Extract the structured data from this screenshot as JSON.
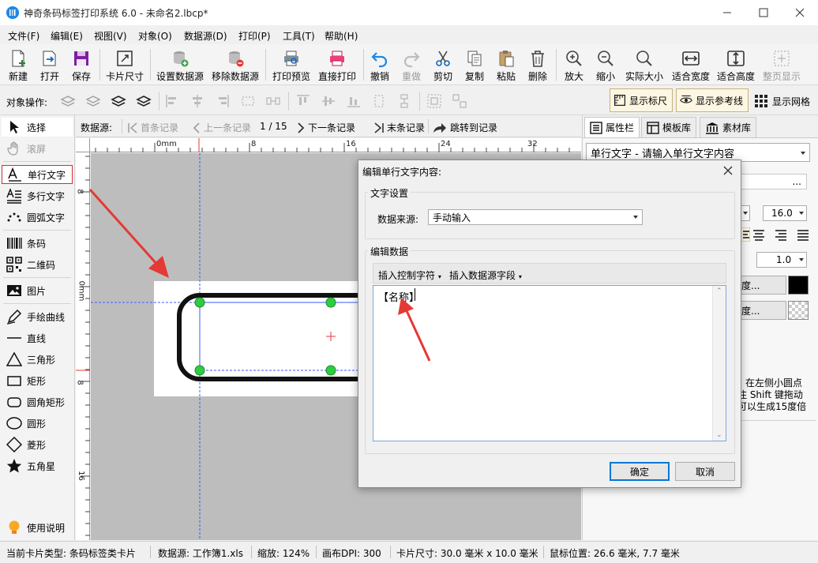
{
  "window": {
    "title": "神奇条码标签打印系统 6.0 - 未命名2.lbcp*",
    "app_icon": "app-logo-icon"
  },
  "menu": [
    "文件(F)",
    "编辑(E)",
    "视图(V)",
    "对象(O)",
    "数据源(D)",
    "打印(P)",
    "工具(T)",
    "帮助(H)"
  ],
  "toolbar": {
    "new": "新建",
    "open": "打开",
    "save": "保存",
    "card_size": "卡片尺寸",
    "set_datasource": "设置数据源",
    "remove_datasource": "移除数据源",
    "print_preview": "打印预览",
    "direct_print": "直接打印",
    "undo": "撤销",
    "redo": "重做",
    "cut": "剪切",
    "copy": "复制",
    "paste": "粘贴",
    "delete": "删除",
    "zoom_in": "放大",
    "zoom_out": "缩小",
    "actual_size": "实际大小",
    "fit_width": "适合宽度",
    "fit_height": "适合高度",
    "full_page": "整页显示"
  },
  "objbar": {
    "label": "对象操作:",
    "show_ruler": "显示标尺",
    "show_guides": "显示参考线",
    "show_grid": "显示网格"
  },
  "tools": {
    "select": "选择",
    "scroll": "滚屏",
    "single_text": "单行文字",
    "multi_text": "多行文字",
    "arc_text": "圆弧文字",
    "barcode": "条码",
    "qrcode": "二维码",
    "image": "图片",
    "freehand": "手绘曲线",
    "line": "直线",
    "triangle": "三角形",
    "rect": "矩形",
    "round_rect": "圆角矩形",
    "ellipse": "圆形",
    "diamond": "菱形",
    "star": "五角星",
    "help": "使用说明"
  },
  "recnav": {
    "label": "数据源:",
    "first": "首条记录",
    "prev": "上一条记录",
    "counter": "1 / 15",
    "next": "下一条记录",
    "last": "末条记录",
    "goto": "跳转到记录"
  },
  "ruler": {
    "h_labels": [
      "0mm",
      "8",
      "16",
      "24",
      "32"
    ],
    "v_labels": [
      "8",
      "0mm",
      "8",
      "16"
    ]
  },
  "rightpanel": {
    "tabs": [
      "属性栏",
      "模板库",
      "素材库"
    ],
    "object_select": "单行文字 - 请输入单行文字内容",
    "font_size": "16.0",
    "line_spacing": "1.0",
    "btn1_suffix": "度...",
    "btn2_suffix": "度...",
    "hint_lines": [
      "在左侧小圆点",
      "注 Shift 键拖动",
      "可以生成15度倍"
    ]
  },
  "dialog": {
    "title": "编辑单行文字内容:",
    "group_text": "文字设置",
    "source_label": "数据来源:",
    "source_value": "手动输入",
    "group_data": "编辑数据",
    "insert_ctrl": "插入控制字符",
    "insert_field": "插入数据源字段",
    "content": "【名称】",
    "ok": "确定",
    "cancel": "取消"
  },
  "status": {
    "card_type": "当前卡片类型: 条码标签类卡片",
    "datasource": "数据源: 工作簿1.xls",
    "zoom": "缩放: 124%",
    "dpi": "画布DPI: 300",
    "card_size": "卡片尺寸: 30.0 毫米 x 10.0 毫米",
    "mouse": "鼠标位置: 26.6 毫米, 7.7 毫米"
  },
  "colors": {
    "accent": "#1e88e5",
    "highlight_red": "#e53935",
    "selection_handle": "#2ecc40",
    "guide_line": "#3d5afe"
  }
}
